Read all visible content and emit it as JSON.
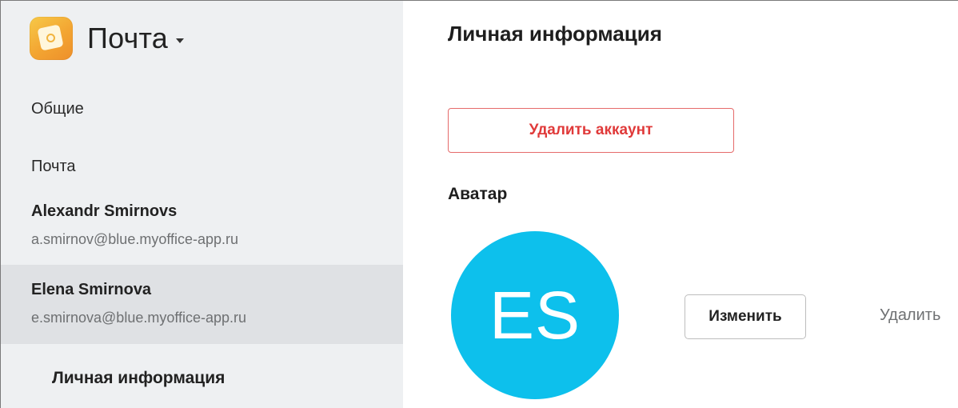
{
  "app": {
    "title": "Почта",
    "logo_icon": "mail-app-icon",
    "accent_gradient": [
      "#f7c948",
      "#ee8f2a"
    ]
  },
  "sidebar": {
    "items": [
      {
        "label": "Общие"
      },
      {
        "label": "Почта"
      }
    ],
    "accounts": [
      {
        "name": "Alexandr Smirnovs",
        "email": "a.smirnov@blue.myoffice-app.ru",
        "selected": false
      },
      {
        "name": "Elena Smirnova",
        "email": "e.smirnova@blue.myoffice-app.ru",
        "selected": true
      }
    ],
    "sub_items": [
      {
        "label": "Личная информация",
        "active": true
      }
    ]
  },
  "main": {
    "title": "Личная информация",
    "delete_account_label": "Удалить аккаунт",
    "avatar_section_label": "Аватар",
    "avatar": {
      "initials": "ES",
      "color": "#0dc0ec"
    },
    "change_label": "Изменить",
    "delete_label": "Удалить"
  },
  "colors": {
    "sidebar_bg": "#eef0f2",
    "selected_bg": "#dfe1e4",
    "danger": "#e03a3a"
  }
}
